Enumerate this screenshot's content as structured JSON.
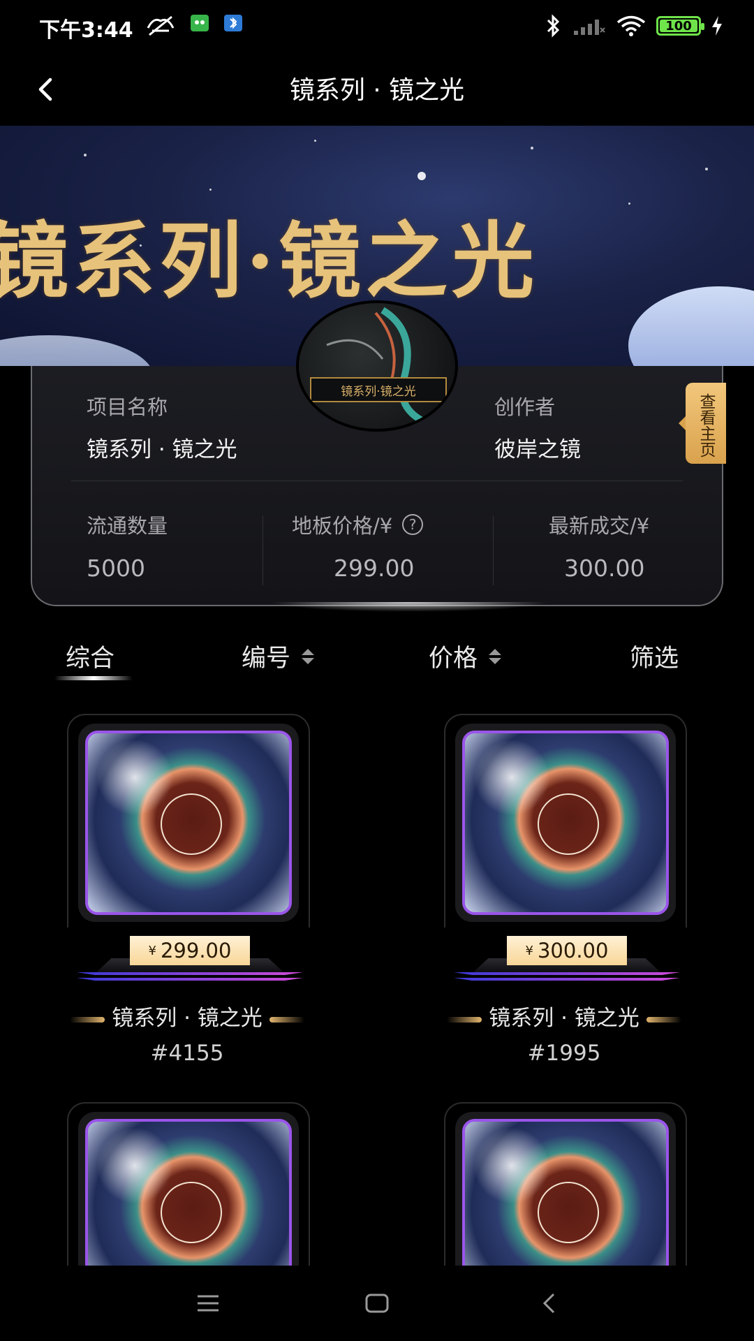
{
  "status_bar": {
    "time": "下午3:44",
    "battery": "100",
    "icons": [
      "mute-icon",
      "app-notification-icon",
      "bluetooth-notification-icon",
      "bluetooth-icon",
      "signal-icon",
      "wifi-icon",
      "battery-icon",
      "charging-icon"
    ]
  },
  "nav": {
    "title": "镜系列 · 镜之光",
    "back_icon": "chevron-left-icon"
  },
  "banner": {
    "title": "镜系列·镜之光",
    "avatar_caption": "镜系列·镜之光"
  },
  "info": {
    "project_label": "项目名称",
    "project_value": "镜系列 · 镜之光",
    "creator_label": "创作者",
    "creator_value": "彼岸之镜",
    "homepage_button": "查看主页",
    "circulation_label": "流通数量",
    "circulation_value": "5000",
    "floor_price_label": "地板价格/¥",
    "floor_price_value": "299.00",
    "last_trade_label": "最新成交/¥",
    "last_trade_value": "300.00"
  },
  "sort_bar": {
    "tabs": [
      {
        "label": "综合",
        "active": true
      },
      {
        "label": "编号",
        "sortable": true
      },
      {
        "label": "价格",
        "sortable": true
      },
      {
        "label": "筛选"
      }
    ]
  },
  "items": [
    {
      "currency": "¥",
      "price": "299.00",
      "name": "镜系列 · 镜之光",
      "number": "#4155"
    },
    {
      "currency": "¥",
      "price": "300.00",
      "name": "镜系列 · 镜之光",
      "number": "#1995"
    },
    {
      "currency": "",
      "price": "",
      "name": "",
      "number": ""
    },
    {
      "currency": "",
      "price": "",
      "name": "",
      "number": ""
    }
  ],
  "system_nav": {
    "icons": [
      "menu-icon",
      "home-icon",
      "back-icon"
    ]
  },
  "colors": {
    "accent_gold": "#e7c27a",
    "price_tag": "#f8d697",
    "art_border": "#9a55ea",
    "battery": "#6fe34a"
  }
}
